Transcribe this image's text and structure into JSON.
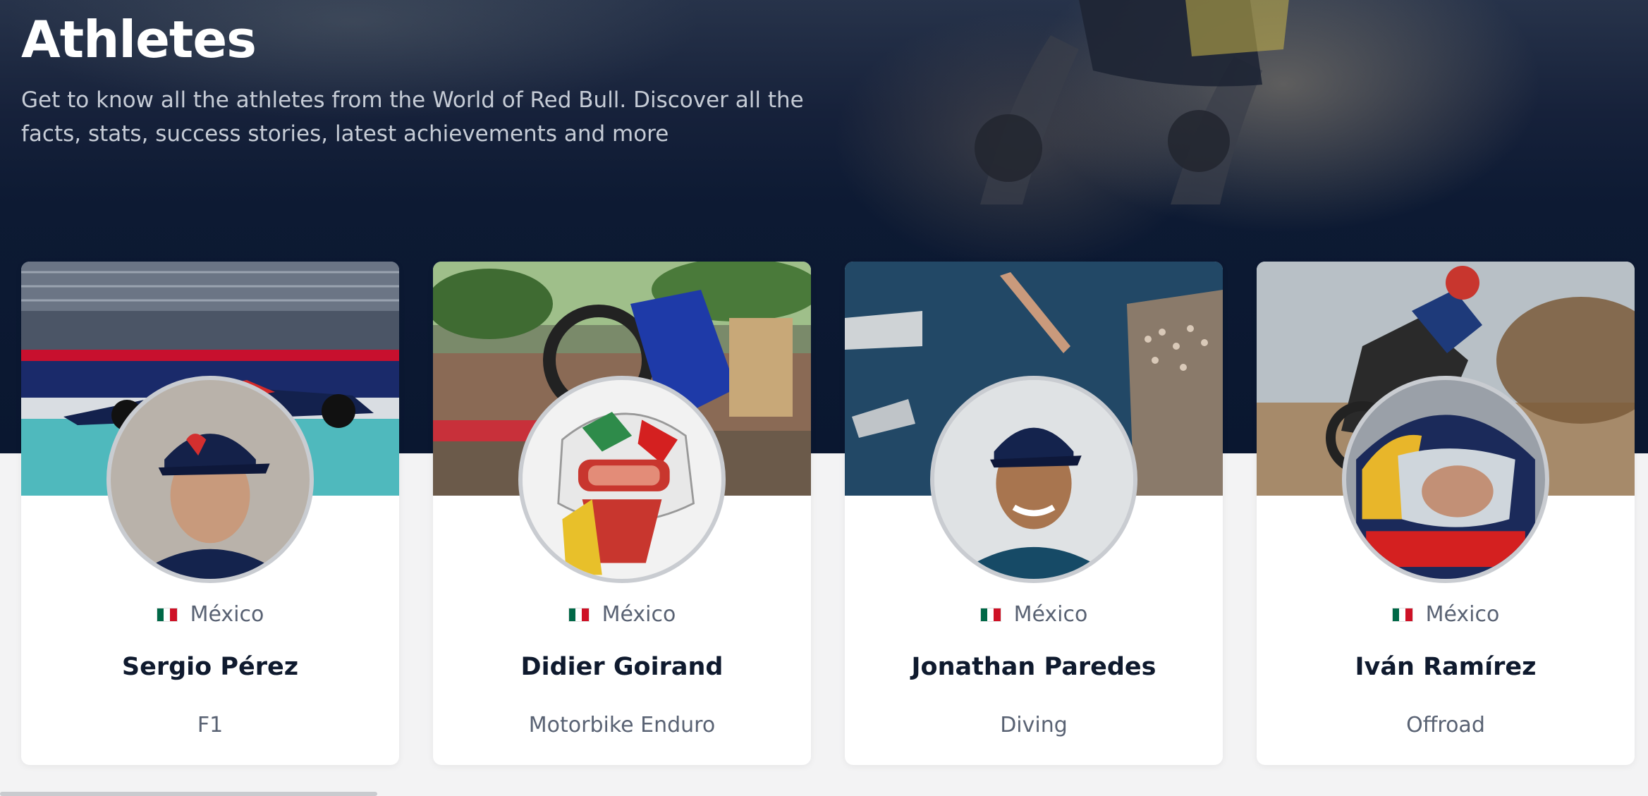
{
  "hero": {
    "title": "Athletes",
    "subtitle": "Get to know all the athletes from the World of Red Bull. Discover all the facts, stats, success stories, latest achievements and more"
  },
  "athletes": [
    {
      "country": "México",
      "name": "Sergio Pérez",
      "sport": "F1"
    },
    {
      "country": "México",
      "name": "Didier Goirand",
      "sport": "Motorbike Enduro"
    },
    {
      "country": "México",
      "name": "Jonathan Paredes",
      "sport": "Diving"
    },
    {
      "country": "México",
      "name": "Iván Ramírez",
      "sport": "Offroad"
    }
  ],
  "colors": {
    "hero_background": "#0a1730",
    "card_background": "#ffffff",
    "name_text": "#0f1a2e",
    "secondary_text": "#596273",
    "avatar_border": "#c9ccd1",
    "flag_green": "#006847",
    "flag_white": "#ffffff",
    "flag_red": "#ce1126"
  },
  "icons": [
    "mexico-flag-icon"
  ]
}
